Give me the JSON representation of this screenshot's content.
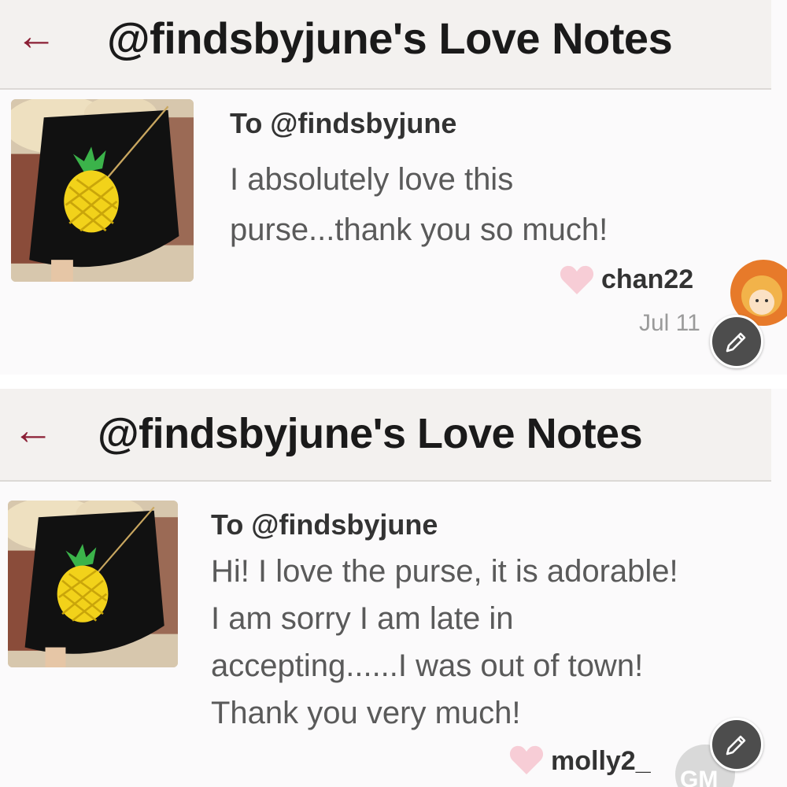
{
  "screenshots": [
    {
      "header": {
        "back_icon": "←",
        "title": "@findsbyjune's Love Notes"
      },
      "note": {
        "to": "To @findsbyjune",
        "message_lines": [
          "I absolutely love this",
          "purse...thank you so much!"
        ],
        "username": "chan22",
        "date": "Jul 11"
      }
    },
    {
      "header": {
        "back_icon": "←",
        "title": "@findsbyjune's Love Notes"
      },
      "note": {
        "to": "To @findsbyjune",
        "message_lines": [
          "Hi! I love the purse, it is adorable!",
          "I am sorry I am late in",
          "accepting......I was out of town!",
          "Thank you very much!"
        ],
        "username": "molly2_",
        "avatar_initials": "GM"
      }
    }
  ],
  "icons": {
    "back": "arrow-left-icon",
    "heart": "heart-icon",
    "edit": "pencil-icon"
  },
  "colors": {
    "accent": "#8b1f35",
    "heart": "#f7cdd6",
    "edit_button": "#4d4d4d",
    "header_bg": "#f3f1ef"
  }
}
